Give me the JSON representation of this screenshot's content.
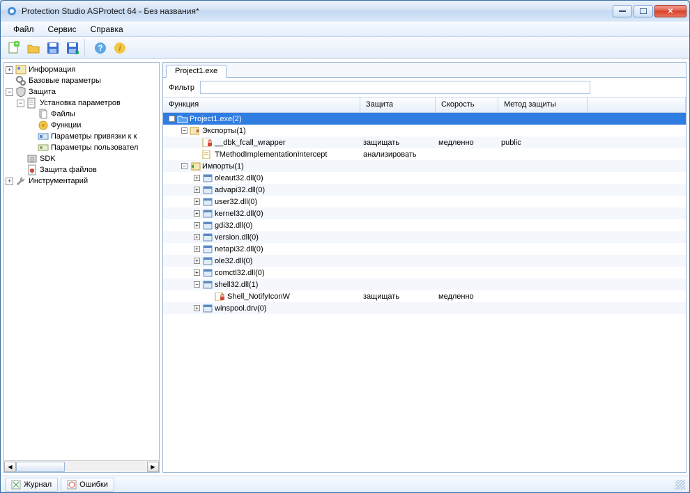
{
  "window": {
    "title": "Protection Studio ASProtect 64 - Без названия*"
  },
  "menu": {
    "file": "Файл",
    "service": "Сервис",
    "help": "Справка"
  },
  "sidebar": {
    "items": [
      {
        "label": "Информация",
        "icon": "info"
      },
      {
        "label": "Базовые параметры",
        "icon": "gears"
      },
      {
        "label": "Защита",
        "icon": "shield",
        "children": [
          {
            "label": "Установка параметров",
            "icon": "page",
            "children": [
              {
                "label": "Файлы",
                "icon": "files"
              },
              {
                "label": "Функции",
                "icon": "func"
              },
              {
                "label": "Параметры привязки к к",
                "icon": "bind"
              },
              {
                "label": "Параметры пользовател",
                "icon": "user"
              }
            ]
          },
          {
            "label": "SDK",
            "icon": "sdk"
          },
          {
            "label": "Защита файлов",
            "icon": "protfile"
          }
        ]
      },
      {
        "label": "Инструментарий",
        "icon": "wrench"
      }
    ]
  },
  "tab": {
    "label": "Project1.exe"
  },
  "filter": {
    "label": "Фильтр",
    "value": ""
  },
  "grid": {
    "headers": {
      "func": "Функция",
      "prot": "Защита",
      "speed": "Скорость",
      "method": "Метод защиты"
    },
    "rows": [
      {
        "depth": 0,
        "exp": "-",
        "ico": "folder",
        "text": "Project1.exe(2)",
        "sel": true
      },
      {
        "depth": 1,
        "exp": "-",
        "ico": "export",
        "text": "Экспорты(1)"
      },
      {
        "depth": 2,
        "exp": "",
        "ico": "lockfn",
        "text": "__dbk_fcall_wrapper",
        "prot": "защищать",
        "speed": "медленно",
        "method": "public"
      },
      {
        "depth": 2,
        "exp": "",
        "ico": "fn",
        "text": "TMethodImplementationIntercept",
        "prot": "анализировать"
      },
      {
        "depth": 1,
        "exp": "-",
        "ico": "import",
        "text": "Импорты(1)"
      },
      {
        "depth": 2,
        "exp": "+",
        "ico": "dll",
        "text": "oleaut32.dll(0)"
      },
      {
        "depth": 2,
        "exp": "+",
        "ico": "dll",
        "text": "advapi32.dll(0)"
      },
      {
        "depth": 2,
        "exp": "+",
        "ico": "dll",
        "text": "user32.dll(0)"
      },
      {
        "depth": 2,
        "exp": "+",
        "ico": "dll",
        "text": "kernel32.dll(0)"
      },
      {
        "depth": 2,
        "exp": "+",
        "ico": "dll",
        "text": "gdi32.dll(0)"
      },
      {
        "depth": 2,
        "exp": "+",
        "ico": "dll",
        "text": "version.dll(0)"
      },
      {
        "depth": 2,
        "exp": "+",
        "ico": "dll",
        "text": "netapi32.dll(0)"
      },
      {
        "depth": 2,
        "exp": "+",
        "ico": "dll",
        "text": "ole32.dll(0)"
      },
      {
        "depth": 2,
        "exp": "+",
        "ico": "dll",
        "text": "comctl32.dll(0)"
      },
      {
        "depth": 2,
        "exp": "-",
        "ico": "dll",
        "text": "shell32.dll(1)"
      },
      {
        "depth": 3,
        "exp": "",
        "ico": "lockfn",
        "text": "Shell_NotifyIconW",
        "prot": "защищать",
        "speed": "медленно"
      },
      {
        "depth": 2,
        "exp": "+",
        "ico": "dll",
        "text": "winspool.drv(0)"
      }
    ]
  },
  "status": {
    "journal": "Журнал",
    "errors": "Ошибки"
  }
}
